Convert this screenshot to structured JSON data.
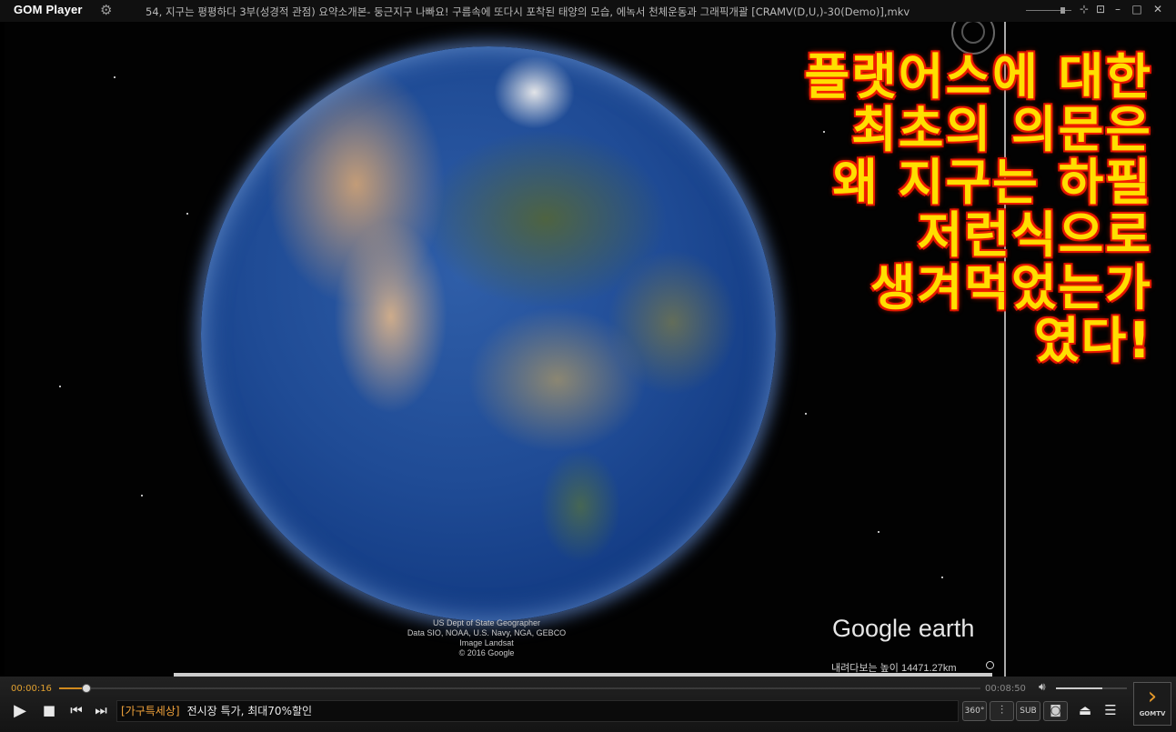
{
  "app": {
    "name": "GOM Player"
  },
  "window": {
    "title": "54, 지구는 평평하다 3부(성경적 관점) 요약소개본- 둥근지구 나빠요! 구름속에 또다시 포착된 태양의 모습, 에녹서 천체운동과 그래픽개괄 [CRAMV(D,U,)-30(Demo)],mkv"
  },
  "video": {
    "overlay_lines": "플랫어스에 대한\n최초의 의문은\n왜 지구는 하필\n저런식으로\n생겨먹었는가\n였다!",
    "credits": [
      "US Dept of State Geographer",
      "Data SIO, NOAA, U.S. Navy, NGA, GEBCO",
      "Image Landsat",
      "© 2016 Google"
    ],
    "watermark_google": "Google",
    "watermark_earth": "earth",
    "altitude_text": "내려다보는 높이 14471.27km"
  },
  "playback": {
    "current_time": "00:00:16",
    "duration": "00:08:50",
    "progress": 0.03,
    "volume": 0.65
  },
  "ticker": {
    "tag": "[가구특세상]",
    "message": "전시장 특가, 최대70%할인"
  },
  "buttons": {
    "btn_360": "360°",
    "btn_sub": "SUB",
    "gomtv": "GOMTV"
  }
}
